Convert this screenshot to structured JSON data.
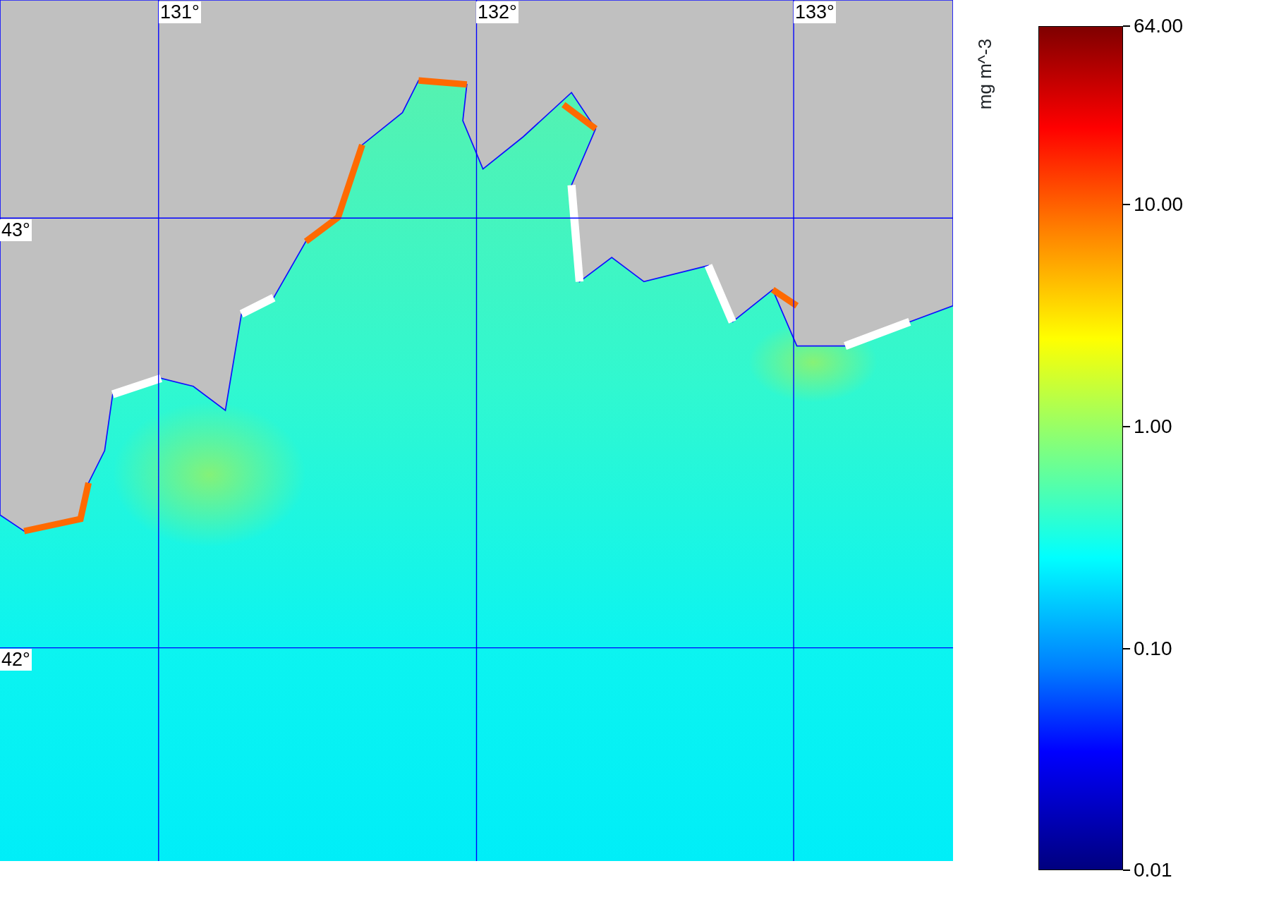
{
  "map": {
    "longitude_labels": [
      "131°",
      "132°",
      "133°"
    ],
    "latitude_labels": [
      "43°",
      "42°"
    ]
  },
  "colorbar": {
    "unit": "mg m^-3",
    "ticks": [
      "64.00",
      "10.00",
      "1.00",
      "0.10",
      "0.01"
    ]
  }
}
